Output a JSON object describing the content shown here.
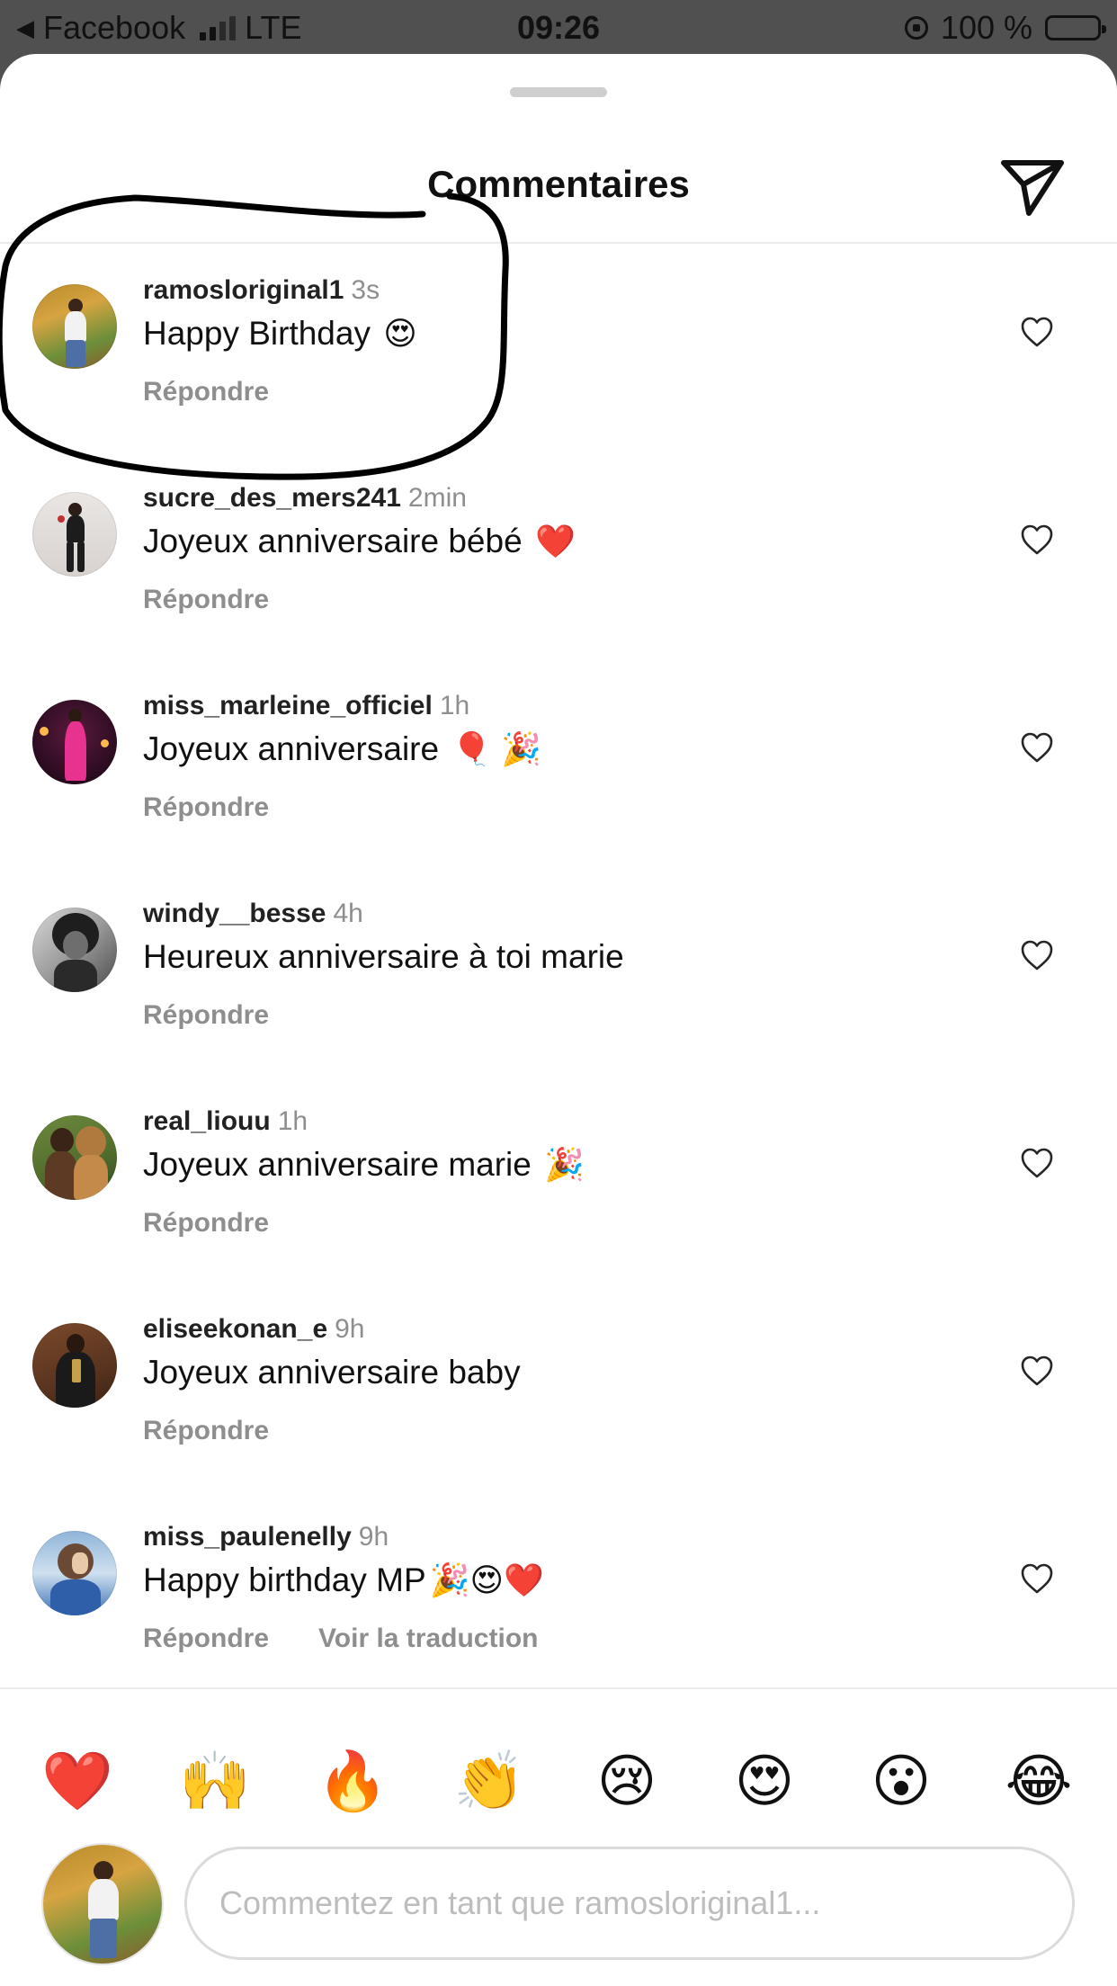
{
  "status_bar": {
    "back_app": "Facebook",
    "network": "LTE",
    "time": "09:26",
    "battery": "100 %"
  },
  "header": {
    "title": "Commentaires",
    "send_icon": "send-icon"
  },
  "comments": [
    {
      "username": "ramosloriginal1",
      "time": "3s",
      "text": "Happy Birthday",
      "emoji": "😍",
      "reply": "Répondre"
    },
    {
      "username": "sucre_des_mers241",
      "time": "2min",
      "text": "Joyeux anniversaire bébé",
      "emoji": "❤️",
      "reply": "Répondre"
    },
    {
      "username": "miss_marleine_officiel",
      "time": "1h",
      "text": "Joyeux anniversaire",
      "emoji": "🎈 🎉",
      "reply": "Répondre"
    },
    {
      "username": "windy__besse",
      "time": "4h",
      "text": "Heureux anniversaire à toi marie",
      "emoji": "",
      "reply": "Répondre"
    },
    {
      "username": "real_liouu",
      "time": "1h",
      "text": "Joyeux anniversaire marie",
      "emoji": "🎉",
      "reply": "Répondre"
    },
    {
      "username": "eliseekonan_e",
      "time": "9h",
      "text": "Joyeux anniversaire baby",
      "emoji": "",
      "reply": "Répondre"
    },
    {
      "username": "miss_paulenelly",
      "time": "9h",
      "text": "Happy birthday MP",
      "emoji": "🎉😍❤️",
      "reply": "Répondre",
      "translate": "Voir la traduction"
    }
  ],
  "emoji_bar": [
    "❤️",
    "🙌",
    "🔥",
    "👏",
    "😢",
    "😍",
    "😮",
    "😂"
  ],
  "composer": {
    "placeholder": "Commentez en tant que ramosloriginal1..."
  },
  "colors": {
    "secondary_text": "#8e8e8e",
    "divider": "#ececec",
    "placeholder": "#bdbdbd"
  }
}
